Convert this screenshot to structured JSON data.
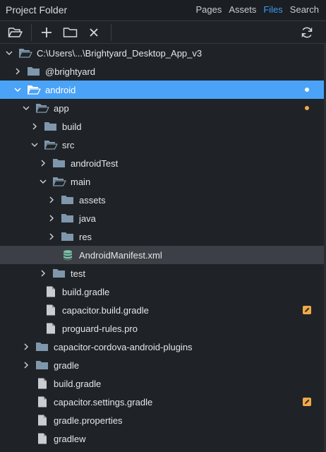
{
  "header": {
    "title": "Project Folder",
    "nav": [
      {
        "label": "Pages",
        "active": false
      },
      {
        "label": "Assets",
        "active": false
      },
      {
        "label": "Files",
        "active": true
      },
      {
        "label": "Search",
        "active": false
      }
    ]
  },
  "toolbar": {
    "open_icon": "folder-open-icon",
    "add_icon": "plus-icon",
    "new_folder_icon": "folder-icon",
    "close_icon": "close-icon",
    "refresh_icon": "refresh-icon"
  },
  "colors": {
    "accent": "#4aa3f7",
    "folder": "#7f97ad",
    "modified": "#f0a94a",
    "manifest": "#7cc2a8"
  },
  "tree": [
    {
      "label": "C:\\Users\\...\\Brightyard_Desktop_App_v3",
      "depth": 0,
      "kind": "folder",
      "expanded": true
    },
    {
      "label": "@brightyard",
      "depth": 1,
      "kind": "folder",
      "expanded": false
    },
    {
      "label": "android",
      "depth": 1,
      "kind": "folder",
      "expanded": true,
      "selected": true,
      "dot": "white"
    },
    {
      "label": "app",
      "depth": 2,
      "kind": "folder",
      "expanded": true,
      "dot": "orange"
    },
    {
      "label": "build",
      "depth": 3,
      "kind": "folder",
      "expanded": false
    },
    {
      "label": "src",
      "depth": 3,
      "kind": "folder",
      "expanded": true
    },
    {
      "label": "androidTest",
      "depth": 4,
      "kind": "folder",
      "expanded": false
    },
    {
      "label": "main",
      "depth": 4,
      "kind": "folder",
      "expanded": true
    },
    {
      "label": "assets",
      "depth": 5,
      "kind": "folder",
      "expanded": false
    },
    {
      "label": "java",
      "depth": 5,
      "kind": "folder",
      "expanded": false
    },
    {
      "label": "res",
      "depth": 5,
      "kind": "folder",
      "expanded": false
    },
    {
      "label": "AndroidManifest.xml",
      "depth": 5,
      "kind": "manifest",
      "highlighted": true
    },
    {
      "label": "test",
      "depth": 4,
      "kind": "folder",
      "expanded": false
    },
    {
      "label": "build.gradle",
      "depth": 3,
      "kind": "file"
    },
    {
      "label": "capacitor.build.gradle",
      "depth": 3,
      "kind": "file",
      "badge": true
    },
    {
      "label": "proguard-rules.pro",
      "depth": 3,
      "kind": "file"
    },
    {
      "label": "capacitor-cordova-android-plugins",
      "depth": 2,
      "kind": "folder",
      "expanded": false
    },
    {
      "label": "gradle",
      "depth": 2,
      "kind": "folder",
      "expanded": false
    },
    {
      "label": "build.gradle",
      "depth": 2,
      "kind": "file"
    },
    {
      "label": "capacitor.settings.gradle",
      "depth": 2,
      "kind": "file",
      "badge": true
    },
    {
      "label": "gradle.properties",
      "depth": 2,
      "kind": "file"
    },
    {
      "label": "gradlew",
      "depth": 2,
      "kind": "file"
    }
  ]
}
